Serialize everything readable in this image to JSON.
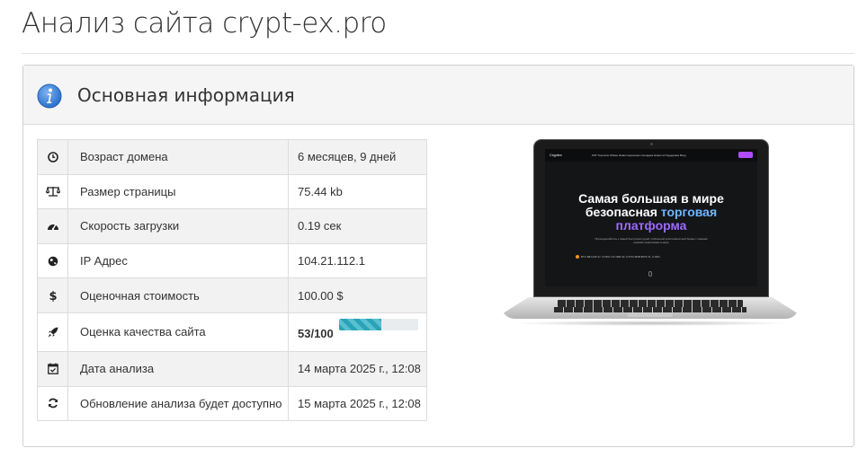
{
  "page": {
    "title": "Анализ сайта crypt-ex.pro"
  },
  "panel": {
    "title": "Основная информация",
    "icon": "info-icon",
    "accent": "#3c7fd6"
  },
  "rows": [
    {
      "icon": "clock-icon",
      "label": "Возраст домена",
      "value": "6 месяцев, 9 дней"
    },
    {
      "icon": "scale-icon",
      "label": "Размер страницы",
      "value": "75.44 kb"
    },
    {
      "icon": "speedometer-icon",
      "label": "Скорость загрузки",
      "value": "0.19 сек"
    },
    {
      "icon": "globe-icon",
      "label": "IP Адрес",
      "value": "104.21.112.1"
    },
    {
      "icon": "dollar-icon",
      "label": "Оценочная стоимость",
      "value": "100.00 $"
    },
    {
      "icon": "rocket-icon",
      "label": "Оценка качества сайта",
      "value": "53/100",
      "progress": 0.53
    },
    {
      "icon": "calendar-check-icon",
      "label": "Дата анализа",
      "value": "14 марта 2025 г., 12:08"
    },
    {
      "icon": "refresh-icon",
      "label": "Обновление анализа будет доступно",
      "value": "15 марта 2025 г., 12:08"
    }
  ],
  "preview": {
    "logo": "Cryptex",
    "nav": "P2P   Торговля   Обмен   Инвестиционная площадка   Новости   Поддержка        Вход",
    "headline_1": "Самая большая в мире",
    "headline_2a": "безопасная ",
    "headline_2b": "торговая",
    "headline_3": "платформа",
    "subtext": "Присоединяйтесь к самой быстрорастущей глобальной криптовалютной бирже с самыми низкими комиссиями в мире",
    "ticker": "BTC $84,025.47  -0.56%     LTC  $86.43  -0.57%     BNB  $575.31  -0.03%"
  }
}
